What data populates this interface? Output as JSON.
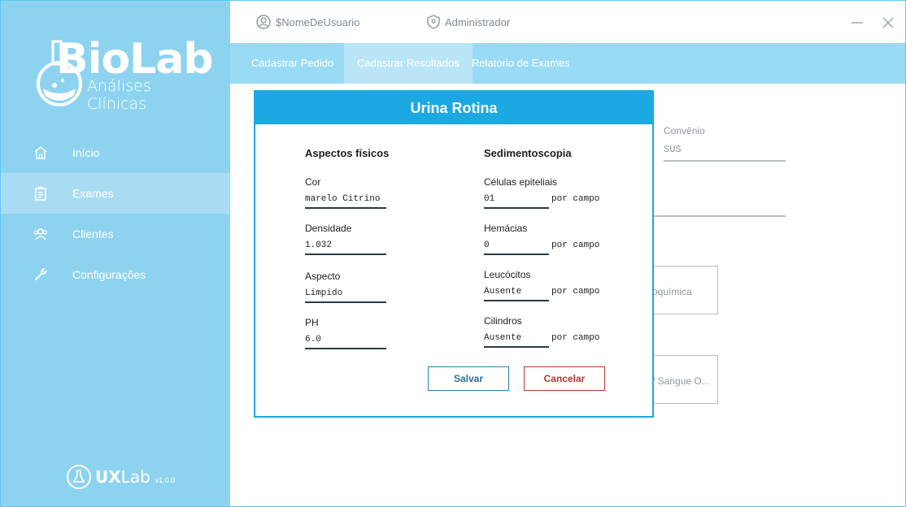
{
  "app": {
    "logo_title": "BioLab",
    "logo_subtitle": "Análises Clínicas",
    "footer_brand_bold": "UX",
    "footer_brand_rest": "Lab",
    "footer_version": "v1.0.0"
  },
  "topbar": {
    "username": "$NomeDeUsuario",
    "role": "Administrador"
  },
  "sidebar": {
    "items": [
      {
        "label": "Início",
        "icon": "home-icon"
      },
      {
        "label": "Exames",
        "icon": "clipboard-icon",
        "active": true
      },
      {
        "label": "Clientes",
        "icon": "users-icon"
      },
      {
        "label": "Configurações",
        "icon": "wrench-icon"
      }
    ]
  },
  "tabs": [
    {
      "label": "Cadastrar Pedido"
    },
    {
      "label": "Cadastrar Resultados",
      "active": true
    },
    {
      "label": "Relatorio de Exames"
    }
  ],
  "background": {
    "convenio_label": "Convênio",
    "convenio_value": "SUS",
    "card1": "oquímica",
    "card2": "/ Sangue O..."
  },
  "modal": {
    "title": "Urina Rotina",
    "left_title": "Aspectos físicos",
    "right_title": "Sedimentoscopia",
    "left_fields": [
      {
        "label": "Cor",
        "value": "marelo Citrino"
      },
      {
        "label": "Densidade",
        "value": "1.032"
      },
      {
        "label": "Aspecto",
        "value": "Limpido"
      },
      {
        "label": "PH",
        "value": "6.0"
      }
    ],
    "right_fields": [
      {
        "label": "Células epiteliais",
        "value": "01",
        "unit": "por campo"
      },
      {
        "label": "Hemácias",
        "value": "0",
        "unit": "por campo"
      },
      {
        "label": "Leucócitos",
        "value": "Ausente",
        "unit": "por campo"
      },
      {
        "label": "Cilindros",
        "value": "Ausente",
        "unit": "por campo"
      }
    ],
    "save_label": "Salvar",
    "cancel_label": "Cancelar"
  },
  "colors": {
    "sidebar": "#8dd3f0",
    "tabs": "#99dbf4",
    "modal_accent": "#1ca8e0",
    "cancel": "#b03a2e"
  }
}
